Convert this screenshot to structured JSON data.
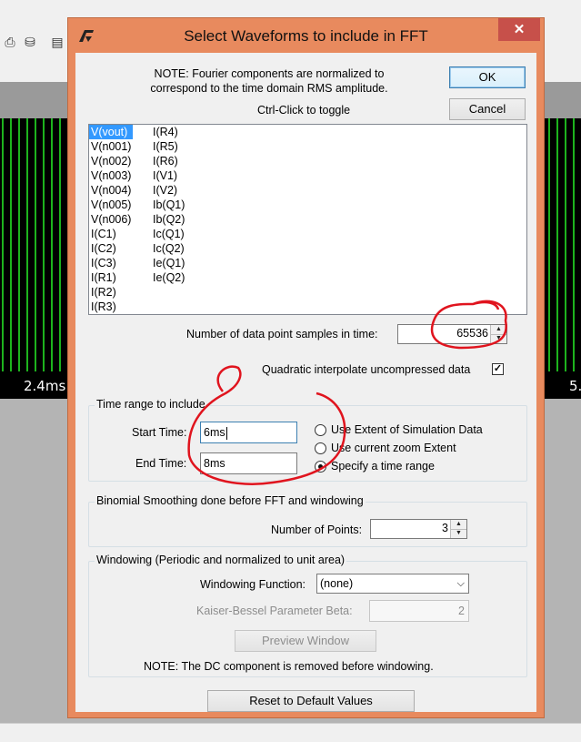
{
  "background_app": {
    "axis_labels": [
      "2.4ms",
      "5."
    ]
  },
  "dialog": {
    "title": "Select Waveforms to include in FFT",
    "close_glyph": "✕",
    "note": "NOTE:  Fourier components are normalized to correspond to the time domain RMS amplitude.",
    "ok_label": "OK",
    "cancel_label": "Cancel",
    "toggle_hint": "Ctrl-Click to toggle",
    "waveforms_col1": [
      "V(vout)",
      "V(n001)",
      "V(n002)",
      "V(n003)",
      "V(n004)",
      "V(n005)",
      "V(n006)",
      "I(C1)",
      "I(C2)",
      "I(C3)",
      "I(R1)",
      "I(R2)",
      "I(R3)"
    ],
    "waveforms_col2": [
      "I(R4)",
      "I(R5)",
      "I(R6)",
      "I(V1)",
      "I(V2)",
      "Ib(Q1)",
      "Ib(Q2)",
      "Ic(Q1)",
      "Ic(Q2)",
      "Ie(Q1)",
      "Ie(Q2)"
    ],
    "selected_waveform": "V(vout)",
    "samples_label": "Number of data point samples in time:",
    "samples_value": "65536",
    "interp_label": "Quadratic interpolate uncompressed data",
    "interp_checked": true,
    "time_range": {
      "group_title": "Time range to include",
      "start_label": "Start Time:",
      "start_value": "6ms",
      "end_label": "End Time:",
      "end_value": "8ms",
      "options": [
        "Use Extent of Simulation Data",
        "Use current zoom Extent",
        "Specify a time range"
      ],
      "selected_option": "Specify a time range"
    },
    "smoothing": {
      "group_title": "Binomial Smoothing done before FFT and windowing",
      "points_label": "Number of Points:",
      "points_value": "3"
    },
    "windowing": {
      "group_title": "Windowing  (Periodic and normalized to unit area)",
      "function_label": "Windowing Function:",
      "function_value": "(none)",
      "beta_label": "Kaiser-Bessel Parameter Beta:",
      "beta_value": "2",
      "preview_label": "Preview Window",
      "note": "NOTE:  The DC component is removed before windowing."
    },
    "reset_label": "Reset to Default Values"
  },
  "colors": {
    "dialog_frame": "#e88a5e",
    "close_button": "#c7504a",
    "waveform": "#1db31d",
    "annotation_ink": "#e0141e",
    "selection": "#3399ff"
  }
}
